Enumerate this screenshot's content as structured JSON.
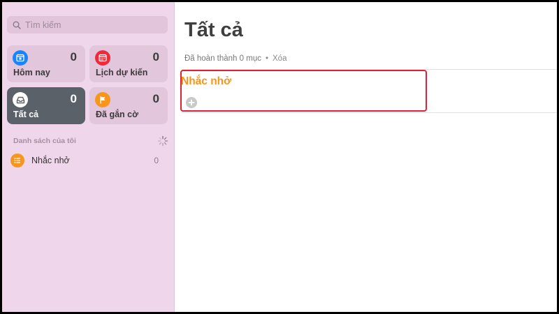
{
  "app": {
    "search": {
      "placeholder": "Tìm kiếm"
    },
    "smart_lists": [
      {
        "id": "today",
        "label": "Hôm nay",
        "count": "0",
        "icon": "calendar-today-icon",
        "color": "#1a84ff"
      },
      {
        "id": "scheduled",
        "label": "Lịch dự kiến",
        "count": "0",
        "icon": "calendar-icon",
        "color": "#ef2b3b"
      },
      {
        "id": "all",
        "label": "Tất cả",
        "count": "0",
        "icon": "tray-icon",
        "color": "#5b6169",
        "selected": true
      },
      {
        "id": "flagged",
        "label": "Đã gắn cờ",
        "count": "0",
        "icon": "flag-icon",
        "color": "#f7951d"
      }
    ],
    "my_lists": {
      "title": "Danh sách của tôi",
      "items": [
        {
          "name": "Nhắc nhở",
          "count": "0",
          "icon": "list-bullet-icon",
          "color": "#f7951d"
        }
      ]
    }
  },
  "main": {
    "title": "Tất cả",
    "completed_text": "Đã hoàn thành 0 mục",
    "separator": "•",
    "clear_label": "Xóa",
    "group": {
      "title": "Nhắc nhở",
      "color": "#f7951d",
      "highlight_color": "#e0203a"
    }
  }
}
